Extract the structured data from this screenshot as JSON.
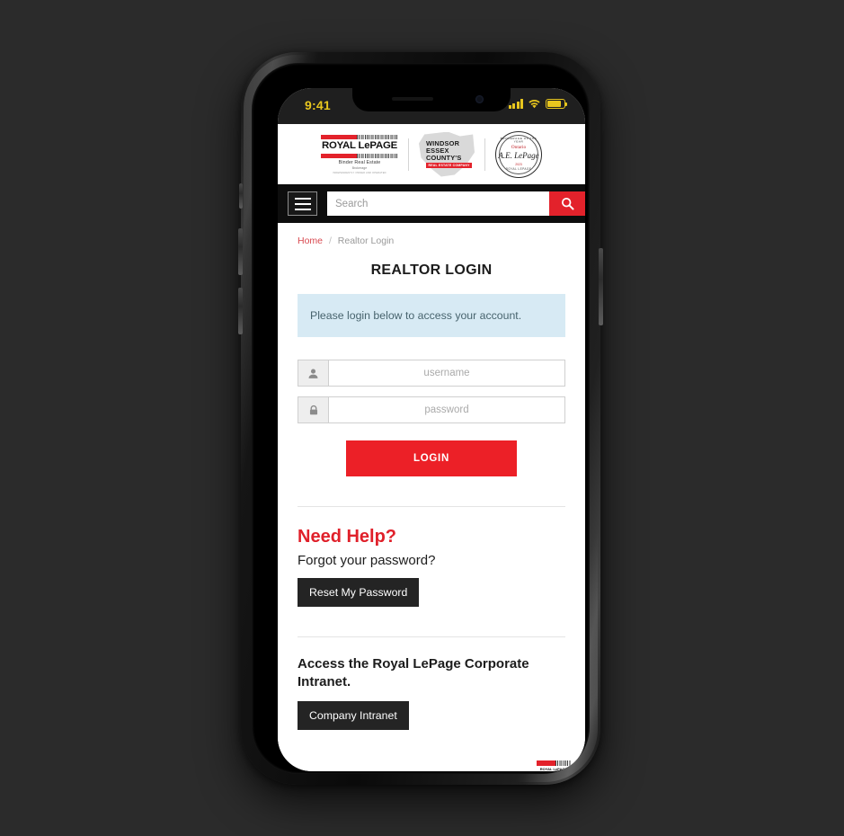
{
  "status_bar": {
    "time": "9:41",
    "signal_icon": "cellular-signal-icon",
    "wifi_icon": "wifi-icon",
    "battery_icon": "battery-icon"
  },
  "header": {
    "royal_lepage": {
      "name_upper": "ROYAL L",
      "name_mixed": "e",
      "name_rest": "PAGE",
      "full_name": "ROYAL LePAGE",
      "brokerage": "Binder Real Estate",
      "brokerage_type": "Brokerage",
      "disclaimer": "INDEPENDENTLY OWNED AND OPERATED"
    },
    "windsor_essex": {
      "line1": "WINDSOR",
      "line2": "ESSEX",
      "line3": "COUNTY'S",
      "banner": "REAL ESTATE COMPANY"
    },
    "seal": {
      "arc_top": "BROKERAGE OF THE YEAR",
      "province": "Ontario",
      "signature": "A.E. LePage",
      "year": "2023",
      "arc_bottom": "ROYAL LEPAGE"
    }
  },
  "nav": {
    "menu_icon": "hamburger-menu-icon",
    "search_placeholder": "Search",
    "search_value": "",
    "search_icon": "search-icon"
  },
  "breadcrumb": {
    "home": "Home",
    "separator": "/",
    "current": "Realtor Login"
  },
  "main": {
    "title": "REALTOR LOGIN",
    "alert": "Please login below to access your account.",
    "form": {
      "username": {
        "icon": "user-icon",
        "placeholder": "username",
        "value": ""
      },
      "password": {
        "icon": "lock-icon",
        "placeholder": "password",
        "value": ""
      },
      "submit_label": "LOGIN"
    },
    "need_help": {
      "title": "Need Help?",
      "question": "Forgot your password?",
      "reset_button": "Reset My Password"
    },
    "intranet": {
      "title": "Access the Royal LePage Corporate Intranet.",
      "button": "Company Intranet"
    }
  },
  "colors": {
    "brand_red": "#ec2027",
    "alert_bg": "#d7eaf4",
    "alert_text": "#48646e",
    "dark_button": "#242424",
    "nav_bar": "#0d0d0d",
    "status_accent": "#e8c61e",
    "backdrop": "#2b2b2b"
  }
}
